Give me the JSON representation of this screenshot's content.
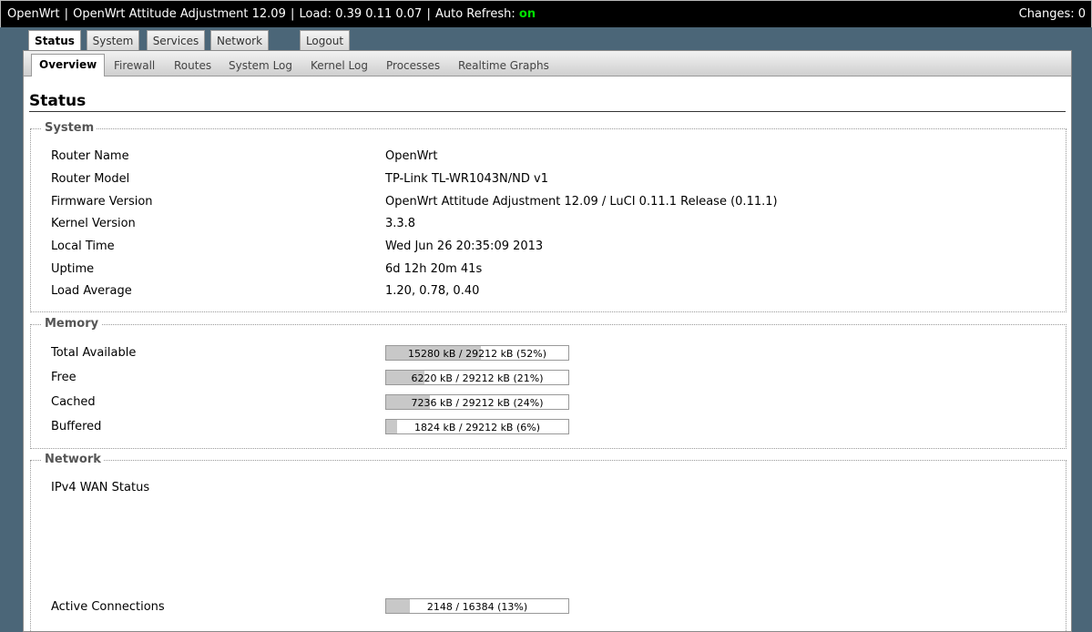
{
  "topbar": {
    "hostname": "OpenWrt",
    "distribution": "OpenWrt Attitude Adjustment 12.09",
    "load_label": "Load: 0.39 0.11 0.07",
    "auto_refresh_label": "Auto Refresh:",
    "auto_refresh_value": "on",
    "changes": "Changes: 0"
  },
  "maintabs": [
    "Status",
    "System",
    "Services",
    "Network"
  ],
  "logout": "Logout",
  "subtabs": [
    "Overview",
    "Firewall",
    "Routes",
    "System Log",
    "Kernel Log",
    "Processes",
    "Realtime Graphs"
  ],
  "page_title": "Status",
  "system": {
    "legend": "System",
    "rows": [
      {
        "label": "Router Name",
        "value": "OpenWrt"
      },
      {
        "label": "Router Model",
        "value": "TP-Link TL-WR1043N/ND v1"
      },
      {
        "label": "Firmware Version",
        "value": "OpenWrt Attitude Adjustment 12.09 / LuCI 0.11.1 Release (0.11.1)"
      },
      {
        "label": "Kernel Version",
        "value": "3.3.8"
      },
      {
        "label": "Local Time",
        "value": "Wed Jun 26 20:35:09 2013"
      },
      {
        "label": "Uptime",
        "value": "6d 12h 20m 41s"
      },
      {
        "label": "Load Average",
        "value": "1.20, 0.78, 0.40"
      }
    ]
  },
  "memory": {
    "legend": "Memory",
    "rows": [
      {
        "label": "Total Available",
        "text": "15280 kB / 29212 kB (52%)",
        "percent": 52
      },
      {
        "label": "Free",
        "text": "6220 kB / 29212 kB (21%)",
        "percent": 21
      },
      {
        "label": "Cached",
        "text": "7236 kB / 29212 kB (24%)",
        "percent": 24
      },
      {
        "label": "Buffered",
        "text": "1824 kB / 29212 kB (6%)",
        "percent": 6
      }
    ]
  },
  "network": {
    "legend": "Network",
    "wan_label": "IPv4 WAN Status",
    "active_connections_label": "Active Connections",
    "active_connections_text": "2148 / 16384 (13%)",
    "active_connections_percent": 13
  }
}
